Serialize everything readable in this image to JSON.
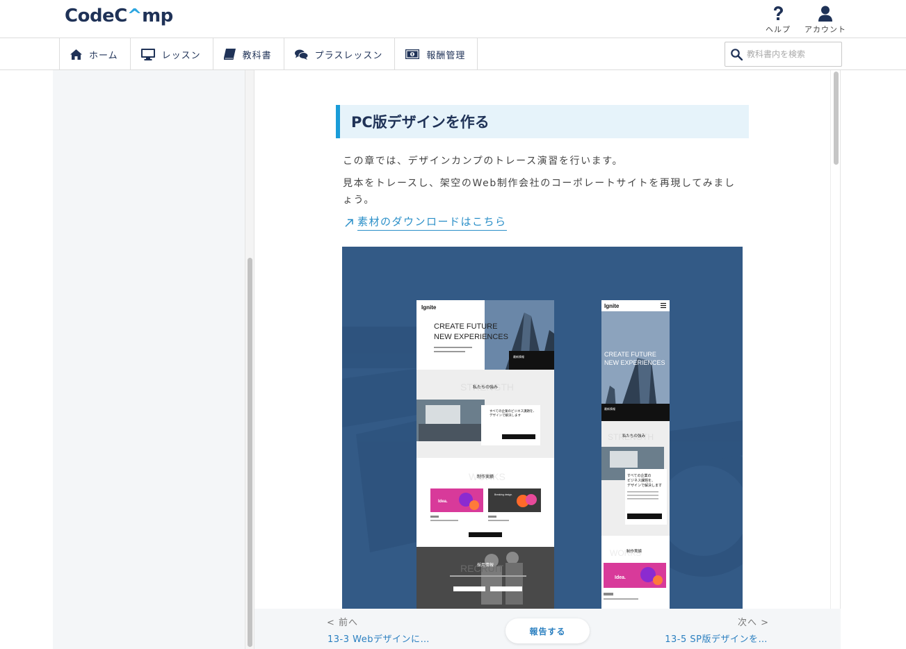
{
  "header": {
    "logo_prefix": "Code",
    "logo_hat": "C",
    "logo_rest": "mp",
    "help_label": "ヘルプ",
    "account_label": "アカウント"
  },
  "nav": {
    "items": [
      {
        "label": "ホーム",
        "icon": "home-icon"
      },
      {
        "label": "レッスン",
        "icon": "monitor-icon"
      },
      {
        "label": "教科書",
        "icon": "book-icon"
      },
      {
        "label": "プラスレッスン",
        "icon": "chat-icon"
      },
      {
        "label": "報酬管理",
        "icon": "money-icon"
      }
    ],
    "search_placeholder": "教科書内を検索"
  },
  "content": {
    "heading": "PC版デザインを作る",
    "para1": "この章では、デザインカンプのトレース演習を行います。",
    "para2": "見本をトレースし、架空のWeb制作会社のコーポレートサイトを再現してみましょう。",
    "download_link": "素材のダウンロードはこちら"
  },
  "mockup": {
    "brand": "Ignite",
    "pc_hero_line1": "CREATE FUTURE",
    "pc_hero_line2": "NEW EXPERIENCES",
    "sp_hero_line1": "CREATE FUTURE",
    "sp_hero_line2": "NEW EXPERIENCES",
    "news_label": "最新情報",
    "strength_bg": "STRENGTH",
    "strength_title": "私たちの強み",
    "strength_copy1": "すべての企業のビジネス課題を、",
    "strength_copy2": "デザインで解決します",
    "works_bg": "WORKS",
    "works_title": "制作実績",
    "works_card1": "Idea.",
    "works_card2": "Breaking design.",
    "recruit_bg": "RECRUIT",
    "recruit_title": "採用情報",
    "sp_strength_copy1": "すべての企業の",
    "sp_strength_copy2": "ビジネス課題を、",
    "sp_strength_copy3": "デザインで解決します"
  },
  "footer": {
    "prev_label": "< 前へ",
    "prev_title": "13-3 Webデザインに…",
    "report_label": "報告する",
    "next_label": "次へ >",
    "next_title": "13-5 SP版デザインを…"
  }
}
